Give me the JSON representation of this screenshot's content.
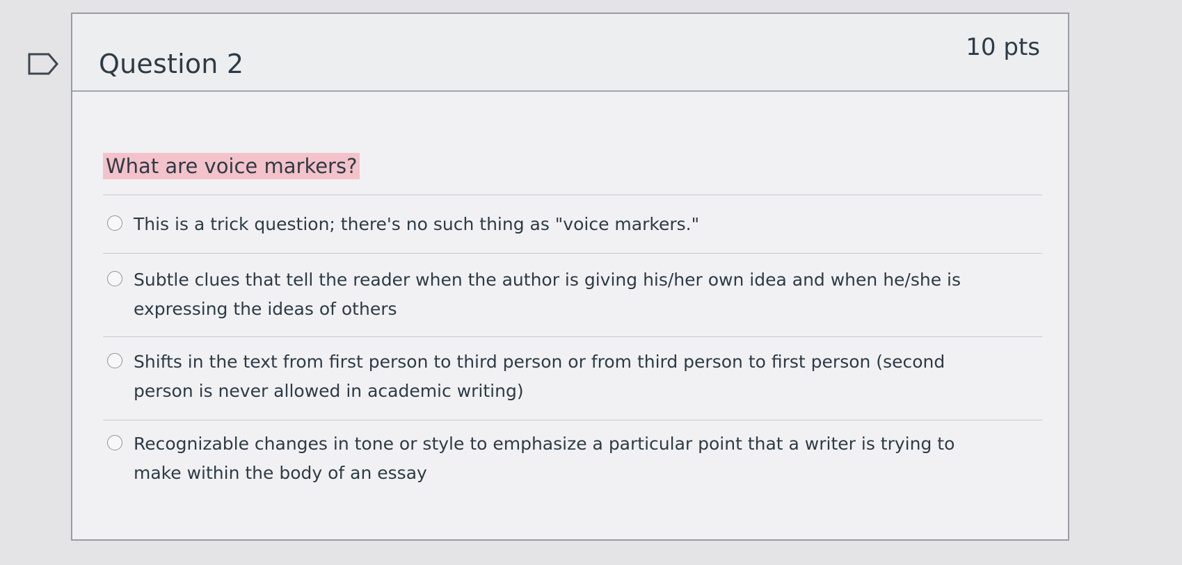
{
  "question": {
    "title": "Question 2",
    "points": "10 pts",
    "text": "What are voice markers?",
    "answers": [
      {
        "label": "This is a trick question; there's no such thing as \"voice markers.\""
      },
      {
        "label": "Subtle clues that tell the reader when the author is giving his/her own idea and when he/she is expressing the ideas of others"
      },
      {
        "label": "Shifts in the text from first person to third person or from third person to first person (second person is never allowed in academic writing)"
      },
      {
        "label": "Recognizable changes in tone or style to emphasize a particular point that a writer is trying to make within the body of an essay"
      }
    ]
  },
  "icons": {
    "flag": "flag-outline-icon",
    "radio": "radio-unselected-icon"
  },
  "colors": {
    "highlight": "#f4c2ca",
    "text": "#2d3b45",
    "header_bg": "#eceef0",
    "border": "#9a9ca2"
  }
}
